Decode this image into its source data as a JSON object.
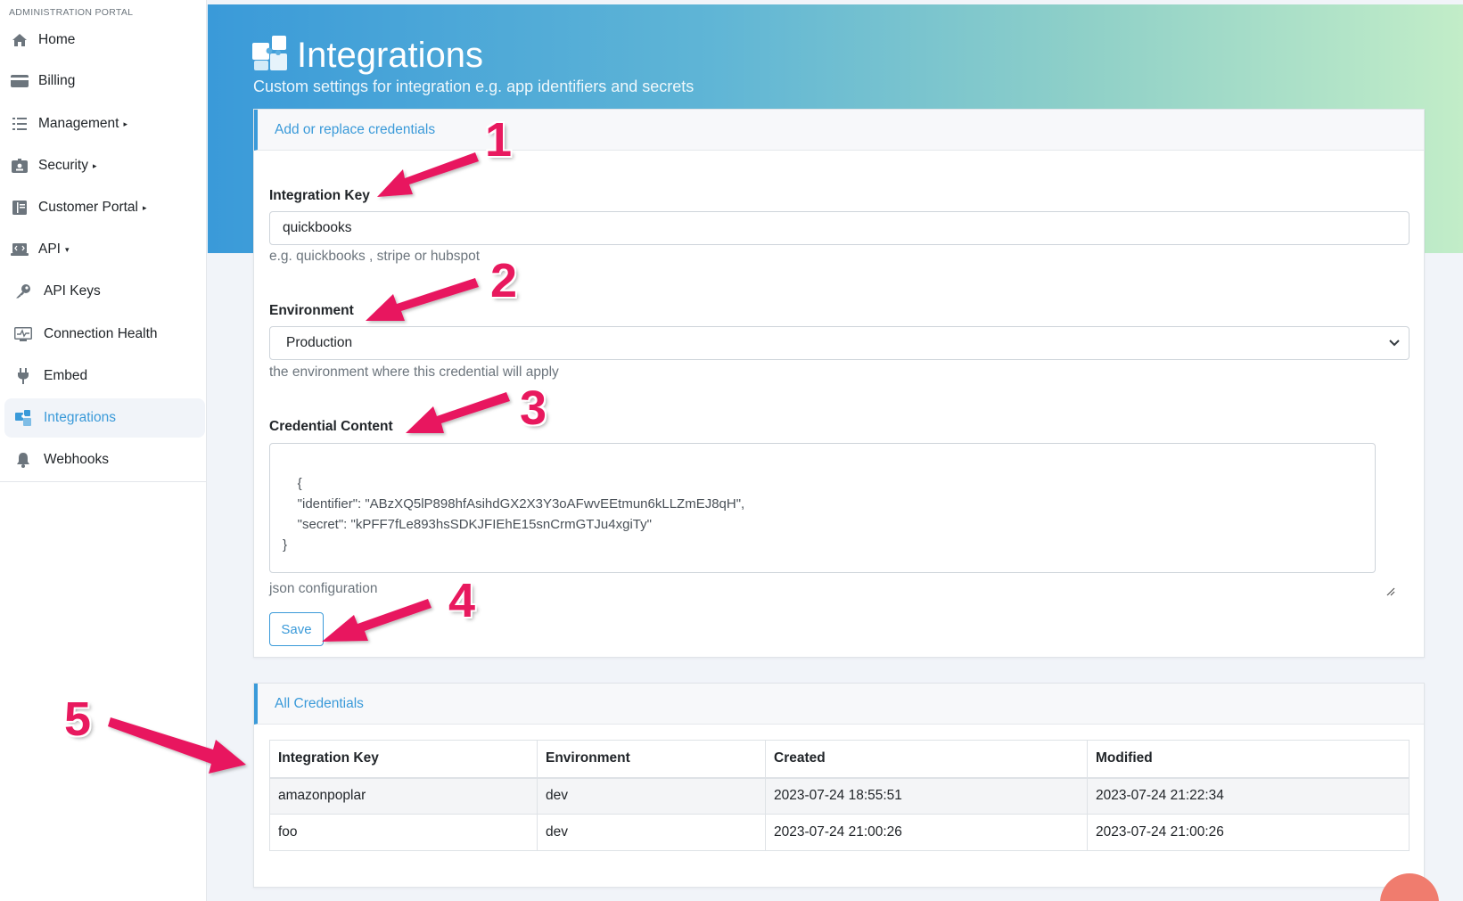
{
  "sidebar": {
    "portal_label": "ADMINISTRATION PORTAL",
    "items": [
      {
        "label": "Home",
        "icon": "home-icon"
      },
      {
        "label": "Billing",
        "icon": "credit-card-icon"
      },
      {
        "label": "Management",
        "icon": "list-icon",
        "caret": "▸"
      },
      {
        "label": "Security",
        "icon": "id-badge-icon",
        "caret": "▸"
      },
      {
        "label": "Customer Portal",
        "icon": "book-icon",
        "caret": "▸"
      },
      {
        "label": "API",
        "icon": "laptop-code-icon",
        "caret": "▾"
      },
      {
        "label": "API Keys",
        "icon": "key-icon"
      },
      {
        "label": "Connection Health",
        "icon": "monitor-pulse-icon"
      },
      {
        "label": "Embed",
        "icon": "plug-icon"
      },
      {
        "label": "Integrations",
        "icon": "puzzle-icon",
        "active": true
      },
      {
        "label": "Webhooks",
        "icon": "bell-icon"
      }
    ]
  },
  "header": {
    "title": "Integrations",
    "subtitle": "Custom settings for integration e.g. app identifiers and secrets",
    "icon": "puzzle-icon"
  },
  "form_card": {
    "header": "Add or replace credentials",
    "integration_key": {
      "label": "Integration Key",
      "value": "quickbooks",
      "help": "e.g. quickbooks , stripe or hubspot"
    },
    "environment": {
      "label": "Environment",
      "selected": "Production",
      "help": "the environment where this credential will apply"
    },
    "credential_content": {
      "label": "Credential Content",
      "value": "{\n    \"identifier\": \"ABzXQ5lP898hfAsihdGX2X3Y3oAFwvEEtmun6kLLZmEJ8qH\",\n    \"secret\": \"kPFF7fLe893hsSDKJFIEhE15snCrmGTJu4xgiTy\"\n}",
      "help": "json configuration"
    },
    "save_label": "Save"
  },
  "credentials_card": {
    "header": "All Credentials",
    "columns": [
      "Integration Key",
      "Environment",
      "Created",
      "Modified"
    ],
    "rows": [
      [
        "amazonpoplar",
        "dev",
        "2023-07-24 18:55:51",
        "2023-07-24 21:22:34"
      ],
      [
        "foo",
        "dev",
        "2023-07-24 21:00:26",
        "2023-07-24 21:00:26"
      ]
    ]
  },
  "annotations": [
    "1",
    "2",
    "3",
    "4",
    "5"
  ],
  "colors": {
    "accent": "#3a9ad9",
    "annotation": "#e8195e",
    "banner_start": "#3a9ad9",
    "banner_end": "#c2edc8"
  }
}
